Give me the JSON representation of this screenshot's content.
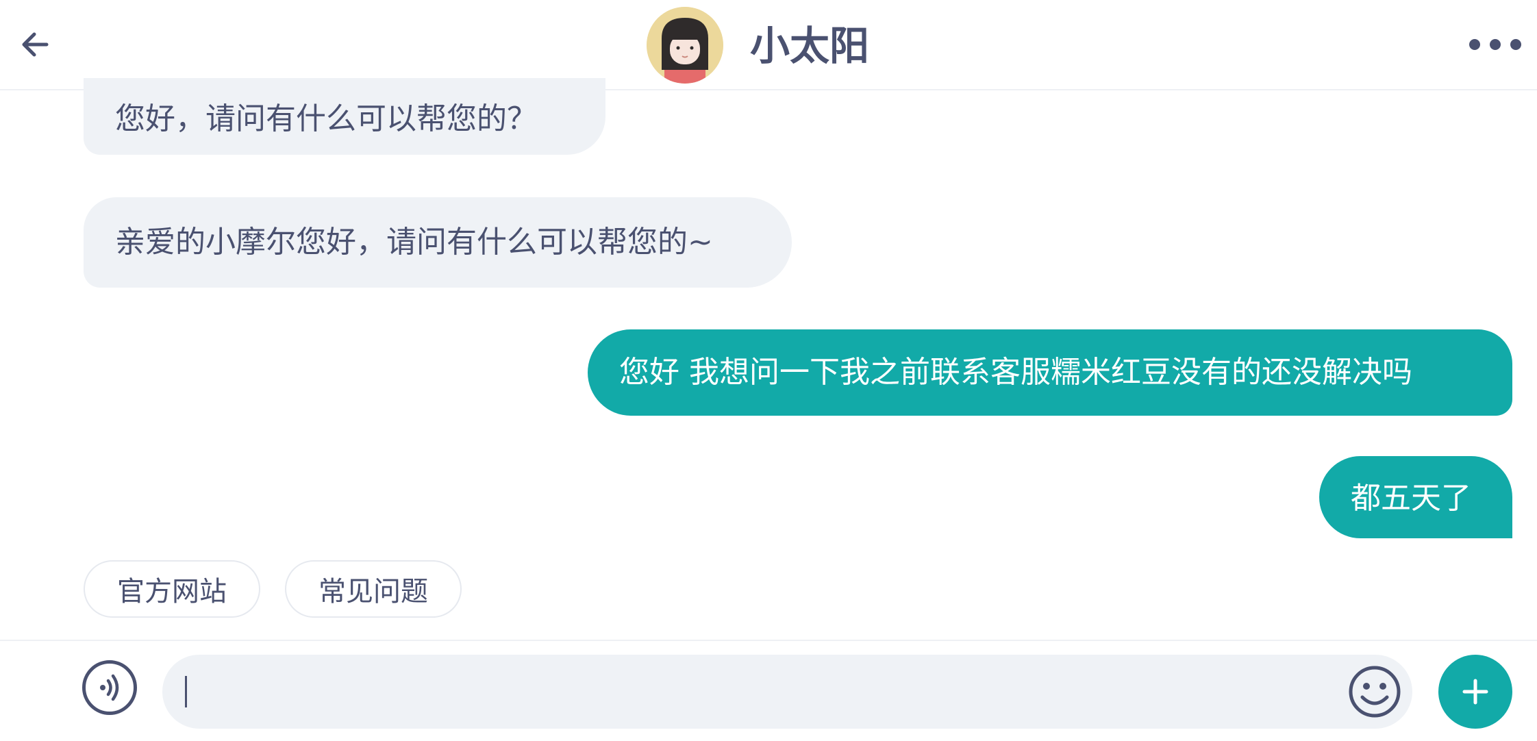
{
  "header": {
    "title": "小太阳",
    "back_icon": "arrow-left-icon",
    "more_icon": "more-horizontal-icon",
    "avatar_icon": "girl-avatar"
  },
  "messages": [
    {
      "side": "in",
      "text": "您好，请问有什么可以帮您的？"
    },
    {
      "side": "in",
      "text": "亲爱的小摩尔您好，请问有什么可以帮您的~"
    },
    {
      "side": "out",
      "text": "您好 我想问一下我之前联系客服糯米红豆没有的还没解决吗"
    },
    {
      "side": "out",
      "text": "都五天了"
    }
  ],
  "quick_replies": [
    {
      "label": "官方网站"
    },
    {
      "label": "常见问题"
    }
  ],
  "composer": {
    "value": "",
    "voice_icon": "voice-icon",
    "emoji_icon": "emoji-icon",
    "add_icon": "plus-icon"
  },
  "colors": {
    "accent": "#12aaa8",
    "incoming_bubble": "#eff2f6",
    "text": "#4a5170"
  }
}
